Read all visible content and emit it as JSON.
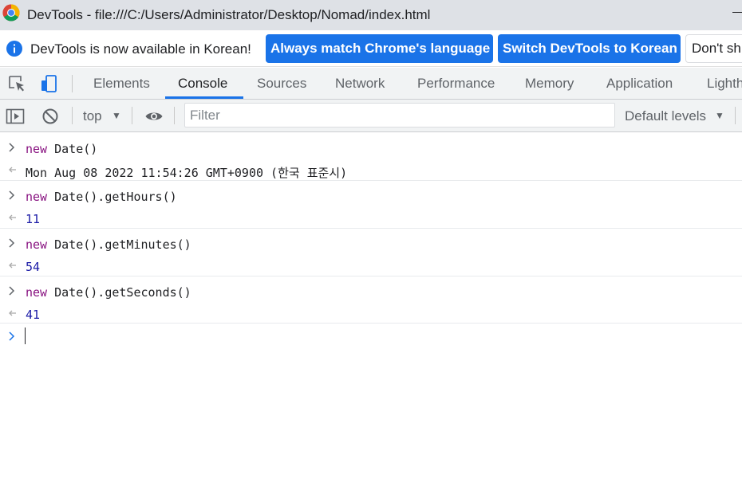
{
  "window": {
    "title": "DevTools - file:///C:/Users/Administrator/Desktop/Nomad/index.html"
  },
  "infobar": {
    "message": "DevTools is now available in Korean!",
    "match_button": "Always match Chrome's language",
    "switch_button": "Switch DevTools to Korean",
    "dismiss_button": "Don't sh"
  },
  "tabs": [
    {
      "label": "Elements",
      "active": false
    },
    {
      "label": "Console",
      "active": true
    },
    {
      "label": "Sources",
      "active": false
    },
    {
      "label": "Network",
      "active": false
    },
    {
      "label": "Performance",
      "active": false
    },
    {
      "label": "Memory",
      "active": false
    },
    {
      "label": "Application",
      "active": false
    },
    {
      "label": "Lighth",
      "active": false
    }
  ],
  "console_toolbar": {
    "context": "top",
    "filter_placeholder": "Filter",
    "levels": "Default levels"
  },
  "console": {
    "entries": [
      {
        "input_keyword": "new",
        "input_rest": " Date()",
        "output": "Mon Aug 08 2022 11:54:26 GMT+0900 (한국 표준시)",
        "output_type": "string"
      },
      {
        "input_keyword": "new",
        "input_rest": " Date().getHours()",
        "output": "11",
        "output_type": "number"
      },
      {
        "input_keyword": "new",
        "input_rest": " Date().getMinutes()",
        "output": "54",
        "output_type": "number"
      },
      {
        "input_keyword": "new",
        "input_rest": " Date().getSeconds()",
        "output": "41",
        "output_type": "number"
      }
    ]
  },
  "colors": {
    "accent": "#1a73e8",
    "keyword": "#881280",
    "number": "#1a1aa6",
    "toolbar_bg": "#f1f3f4",
    "titlebar_bg": "#dee1e6"
  }
}
